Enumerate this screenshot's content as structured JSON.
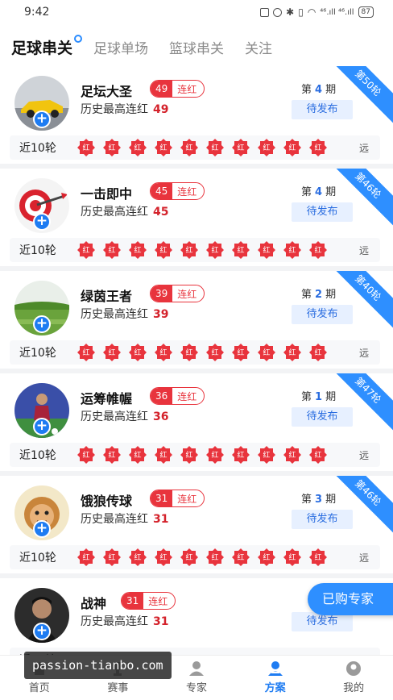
{
  "status_bar": {
    "time": "9:42",
    "signal": "⁴⁶.ıll ⁴⁶.ıll",
    "battery": "87"
  },
  "tabs": [
    {
      "label": "足球串关",
      "active": true
    },
    {
      "label": "足球单场",
      "active": false
    },
    {
      "label": "篮球串关",
      "active": false
    },
    {
      "label": "关注",
      "active": false
    }
  ],
  "common": {
    "streak_word": "连红",
    "history_label": "历史最高连红",
    "issue_prefix": "第",
    "issue_suffix": "期",
    "pending": "待发布",
    "recent_label": "近10轮",
    "badge_text": "红",
    "far_label": "远"
  },
  "experts": [
    {
      "name": "足坛大圣",
      "streak": "49",
      "history": "49",
      "issue": "4",
      "ribbon": "第50轮",
      "avatar_icon": "sports-car-avatar"
    },
    {
      "name": "一击即中",
      "streak": "45",
      "history": "45",
      "issue": "4",
      "ribbon": "第46轮",
      "avatar_icon": "dart-target-avatar"
    },
    {
      "name": "绿茵王者",
      "streak": "39",
      "history": "39",
      "issue": "2",
      "ribbon": "第40轮",
      "avatar_icon": "green-field-avatar"
    },
    {
      "name": "运筹帷幄",
      "streak": "36",
      "history": "36",
      "issue": "1",
      "ribbon": "第47轮",
      "avatar_icon": "soccer-player-avatar"
    },
    {
      "name": "饿狼传球",
      "streak": "31",
      "history": "31",
      "issue": "3",
      "ribbon": "第46轮",
      "avatar_icon": "cartoon-face-avatar"
    },
    {
      "name": "战神",
      "streak": "31",
      "history": "31",
      "issue": "",
      "ribbon": "",
      "avatar_icon": "man-portrait-avatar"
    }
  ],
  "fab_label": "已购专家",
  "bottom_tabs": [
    {
      "label": "首页",
      "icon": "home-icon",
      "active": false
    },
    {
      "label": "赛事",
      "icon": "trophy-icon",
      "active": false
    },
    {
      "label": "专家",
      "icon": "expert-icon",
      "active": false
    },
    {
      "label": "方案",
      "icon": "plan-icon",
      "active": true
    },
    {
      "label": "我的",
      "icon": "profile-icon",
      "active": false
    }
  ],
  "watermark": "passion-tianbo.com",
  "colors": {
    "accent_blue": "#2e8fff",
    "red": "#e8343d"
  }
}
